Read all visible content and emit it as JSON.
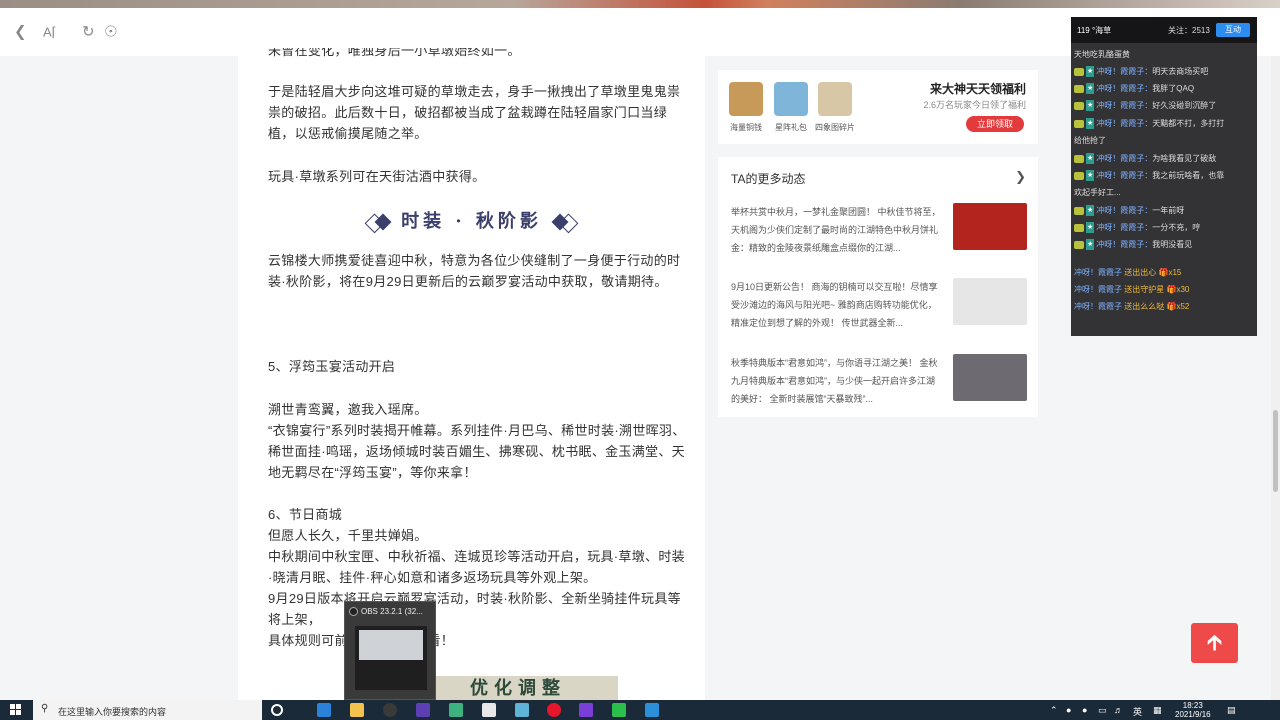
{
  "browser": {
    "back_icon": "back-arrow-icon",
    "read_mode_icon": "reader-mode-icon",
    "refresh_icon": "refresh-icon",
    "stop_icon": "compass-icon"
  },
  "article": {
    "line_top": "未曾在变化，唯独身后一小草墩始终如一。",
    "p1": "于是陆轻眉大步向这堆可疑的草墩走去，身手一揪拽出了草墩里鬼鬼祟祟的破招。此后数十日，破招都被当成了盆栽蹲在陆轻眉家门口当绿植，以惩戒偷摸尾随之举。",
    "p2": "玩具·草墩系列可在天街沽酒中获得。",
    "heading": "时装 · 秋阶影",
    "p3": "云锦楼大师携爱徒喜迎中秋，特意为各位少侠缝制了一身便于行动的时装·秋阶影，将在9月29日更新后的云巅罗宴活动中获取，敬请期待。",
    "h5": "5、浮筠玉宴活动开启",
    "p4": "溯世青鸾翼，邀我入瑶席。",
    "p5": "“衣锦宴行”系列时装揭开帷幕。系列挂件·月巴乌、稀世时装·溯世晖羽、稀世面挂·鸣瑶，返场倾城时装百媚生、拂寒砚、枕书眠、金玉满堂、天地无羁尽在“浮筠玉宴”，等你来拿！",
    "h6": "6、节日商城",
    "p6": "但愿人长久，千里共婵娟。",
    "p7": "中秋期间中秋宝匣、中秋祈福、连城觅珍等活动开启，玩具·草墩、时装·晓清月眠、挂件·秤心如意和诸多返场玩具等外观上架。",
    "p8": "9月29日版本将开启云巅罗宴活动，时装·秋阶影、全新坐骑挂件玩具等将上架，",
    "p9": "具体规则可前往“                节”界面查看！",
    "bottom_banner": "优化调整"
  },
  "promo": {
    "items": [
      {
        "label": "海量铜钱",
        "color": "#c89a5a"
      },
      {
        "label": "星阵礼包",
        "color": "#7fb5d9"
      },
      {
        "label": "四象图碎片",
        "color": "#d8c7a6"
      }
    ],
    "title": "来大神天天领福利",
    "subtitle": "2.6万名玩家今日领了福利",
    "button": "立即领取"
  },
  "more": {
    "header": "TA的更多动态",
    "chevron_icon": "chevron-right-icon",
    "items": [
      {
        "text": "举杯共赏中秋月，一梦礼金聚团圆！ 中秋佳节将至，天机阁为少侠们定制了最时尚的江湖特色中秋月饼礼金：精致的金陵夜景纸雕盒点缀你的江湖...",
        "thumb": "#b3241e"
      },
      {
        "text": "9月10日更新公告！ 商海的钥楠可以交互啦！尽情享受沙滩边的海风与阳光吧~ 雅韵商店购转功能优化，精准定位到想了解的外观！ 传世武器全新...",
        "thumb": "#e6e6e6"
      },
      {
        "text": "秋季特典版本“君意如鸿”，与你语寻江湖之美！ 金秋九月特典版本“君意如鸿”，与少侠一起开启许多江湖的美好： 全新时装展馆“天暴致残”...",
        "thumb": "#6d6a72"
      }
    ]
  },
  "chat": {
    "live_label": "119 °海草",
    "fans": "关注：2513",
    "button": "互动",
    "lines": [
      {
        "text": "天地吃乳酪蛋黄",
        "kind": "plain"
      },
      {
        "user": "冲呀！霞霞子：",
        "msg": "明天去商场买吧",
        "kind": "msg"
      },
      {
        "user": "冲呀！霞霞子：",
        "msg": "我胖了QAQ",
        "kind": "msg"
      },
      {
        "user": "冲呀！霞霞子：",
        "msg": "好久没碰到沉醉了",
        "kind": "msg"
      },
      {
        "user": "冲呀！霞霞子：",
        "msg": "天黯都不打，多打打",
        "kind": "msg"
      },
      {
        "text": "给他抢了",
        "kind": "plain"
      },
      {
        "user": "冲呀！霞霞子：",
        "msg": "为啥我看见了破敌",
        "kind": "msg"
      },
      {
        "user": "冲呀！霞霞子：",
        "msg": "我之前玩啥看，也靠",
        "kind": "msg"
      },
      {
        "text": "欢起手好工...",
        "kind": "plain"
      },
      {
        "user": "冲呀！霞霞子：",
        "msg": "一年前呀",
        "kind": "msg"
      },
      {
        "user": "冲呀！霞霞子：",
        "msg": "一分不充，哼",
        "kind": "msg"
      },
      {
        "user": "冲呀！霞霞子：",
        "msg": "我明没看见",
        "kind": "msg"
      }
    ],
    "gifts": [
      {
        "user": "冲呀！霞霞子",
        "action": "送出出心",
        "count": "x15"
      },
      {
        "user": "冲呀！霞霞子",
        "action": "送出守护星",
        "count": "x30"
      },
      {
        "user": "冲呀！霞霞子",
        "action": "送出么么哒",
        "count": "x52"
      }
    ]
  },
  "scroll_top_icon": "arrow-up-icon",
  "obs": {
    "title": "OBS 23.2.1 (32..."
  },
  "taskbar": {
    "search_placeholder": "在这里输入你要搜索的内容",
    "lang": "英",
    "time": "18:23",
    "date": "2021/9/16",
    "apps": [
      {
        "name": "cortana-icon",
        "color": "#1b2a38"
      },
      {
        "name": "edge-icon",
        "color": "#2b82d9"
      },
      {
        "name": "file-explorer-icon",
        "color": "#f2c14e"
      },
      {
        "name": "obs-icon",
        "color": "#3a3a3a"
      },
      {
        "name": "app-icon-1",
        "color": "#5b3fb3"
      },
      {
        "name": "app-icon-2",
        "color": "#3fb37f"
      },
      {
        "name": "app-icon-3",
        "color": "#e8e8e8"
      },
      {
        "name": "app-icon-4",
        "color": "#5fb3d6"
      },
      {
        "name": "weibo-icon",
        "color": "#e6162d"
      },
      {
        "name": "app-icon-5",
        "color": "#7a3fd6"
      },
      {
        "name": "wechat-icon",
        "color": "#2bbf4c"
      },
      {
        "name": "app-icon-6",
        "color": "#2b8fd9"
      }
    ]
  }
}
